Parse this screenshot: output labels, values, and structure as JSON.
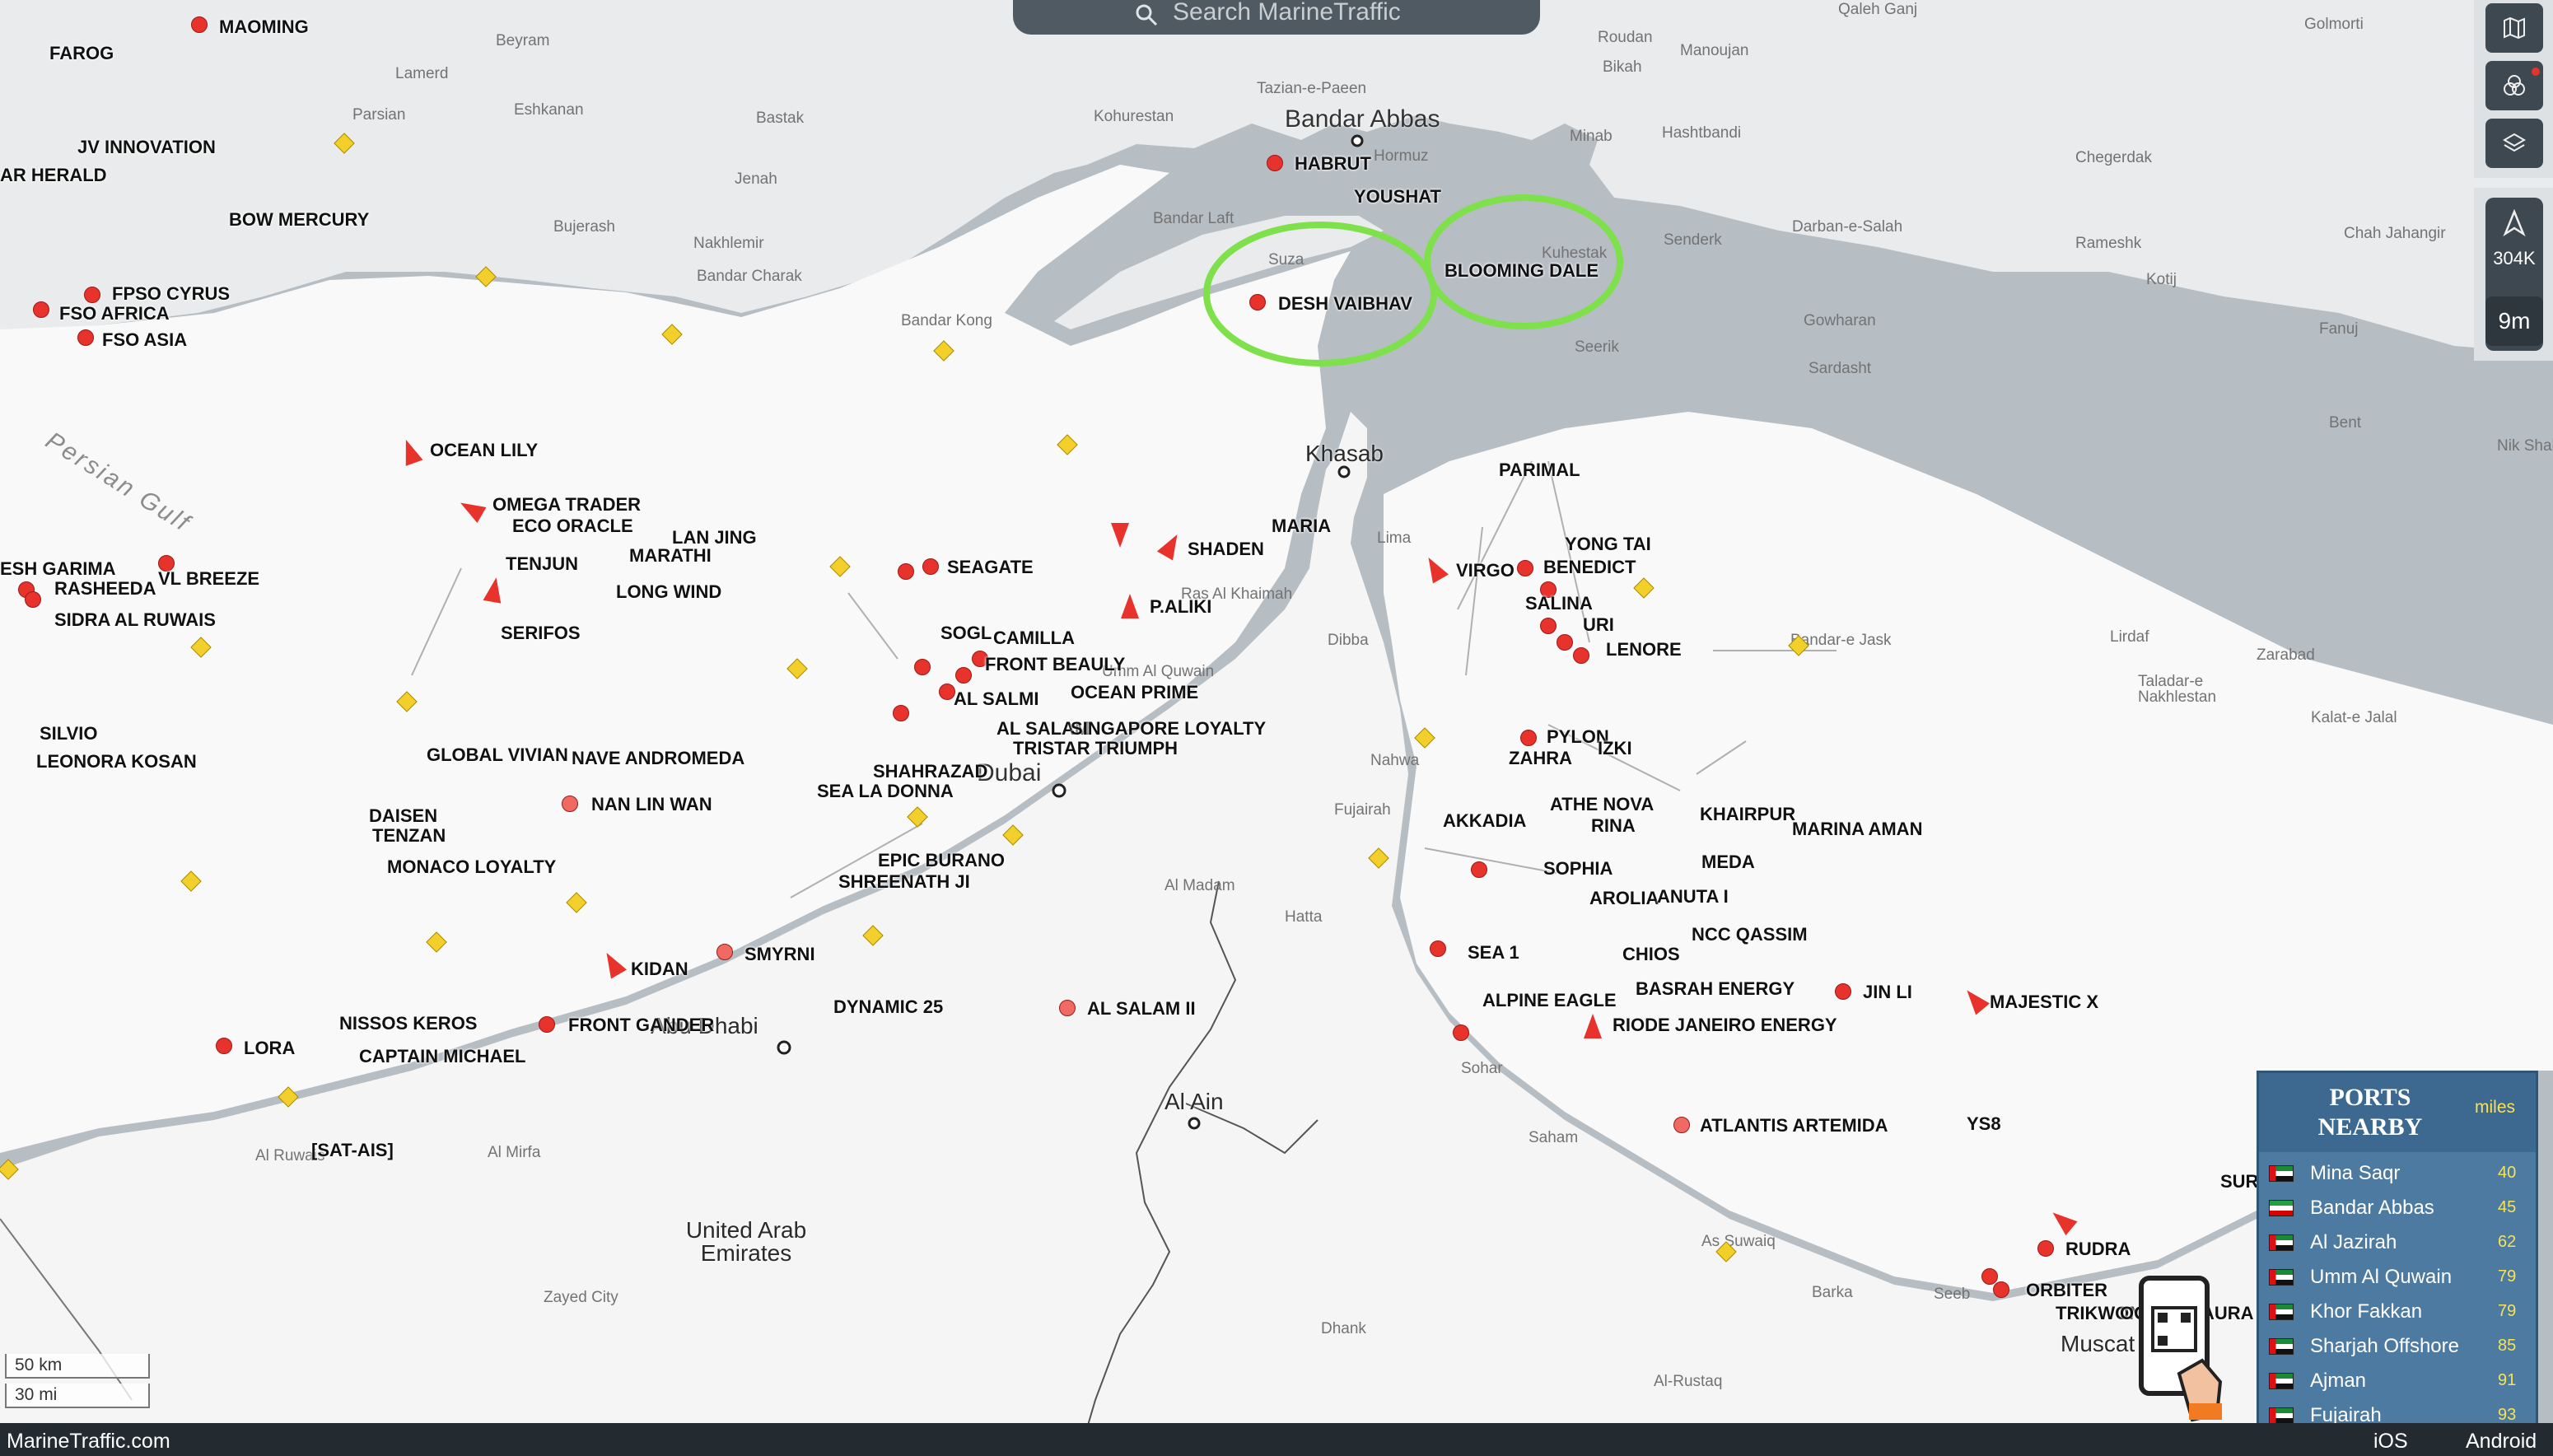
{
  "search": {
    "placeholder": "Search MarineTraffic"
  },
  "footer": {
    "brand": "MarineTraffic.com",
    "ios": "iOS",
    "android": "Android"
  },
  "zoom_panel": {
    "vessels": "304K",
    "range": "9m"
  },
  "scale": {
    "km": "50 km",
    "mi": "30 mi"
  },
  "ports_nearby": {
    "title": "PORTS NEARBY",
    "unit": "miles",
    "ports": [
      {
        "name": "Mina Saqr",
        "distance": "40",
        "flag": "uae"
      },
      {
        "name": "Bandar Abbas",
        "distance": "45",
        "flag": "iran"
      },
      {
        "name": "Al Jazirah",
        "distance": "62",
        "flag": "uae"
      },
      {
        "name": "Umm Al Quwain",
        "distance": "79",
        "flag": "uae"
      },
      {
        "name": "Khor Fakkan",
        "distance": "79",
        "flag": "uae"
      },
      {
        "name": "Sharjah Offshore",
        "distance": "85",
        "flag": "uae"
      },
      {
        "name": "Ajman",
        "distance": "91",
        "flag": "uae"
      },
      {
        "name": "Fujairah",
        "distance": "93",
        "flag": "uae"
      }
    ]
  },
  "map": {
    "highlight_color": "#7ee04a",
    "cities": [
      "Bandar Abbas",
      "Khasab",
      "Dubai",
      "Abu Dhabi",
      "Al Ain",
      "Muscat"
    ],
    "regions": [
      "Persian Gulf",
      "United Arab Emirates"
    ],
    "places": [
      "Beyram",
      "Lamerd",
      "Parsian",
      "Eshkanan",
      "Bastak",
      "Kohurestan",
      "Jenah",
      "Bujerash",
      "Nakhlemir",
      "Bandar Charak",
      "Bandar Laft",
      "Suza",
      "Hormuz",
      "Minab",
      "Hashtbandi",
      "Roudan",
      "Bikah",
      "Manoujan",
      "Qaleh Ganj",
      "Golmorti",
      "Chegerdak",
      "Tazian-e-Paeen",
      "Kuhestak",
      "Senderk",
      "Darban-e-Salah",
      "Rameshk",
      "Chah Jahangir",
      "Kotij",
      "Fanuj",
      "Gowharan",
      "Sardasht",
      "Seerik",
      "Bandar Kong",
      "Bent",
      "Nik Shahr",
      "Lirdaf",
      "Zarabad",
      "Taladar-e Nakhlestan",
      "Kalat-e Jalal",
      "Bandar-e Jask",
      "Lima",
      "Dibba",
      "Nahwa",
      "Fujairah",
      "Ras Al Khaimah",
      "Umm Al Quwain",
      "Al Madam",
      "Hatta",
      "Sohar",
      "Saham",
      "As Suwaiq",
      "Barka",
      "Seeb",
      "Al-Rustaq",
      "Dhank",
      "Zayed City",
      "Al Mirfa",
      "Al Ruwais"
    ],
    "vessels": [
      "MAOMING",
      "FAROG",
      "JV INNOVATION",
      "AR HERALD",
      "BOW MERCURY",
      "FPSO CYRUS",
      "FSO AFRICA",
      "FSO ASIA",
      "OCEAN LILY",
      "OMEGA TRADER",
      "ECO ORACLE",
      "LAN JING",
      "MARATHI",
      "TENJUN",
      "ESH GARIMA",
      "VL BREEZE",
      "RASHEEDA",
      "LONG WIND",
      "SIDRA AL RUWAIS",
      "SERIFOS",
      "SILVIO",
      "LEONORA KOSAN",
      "GLOBAL VIVIAN",
      "NAVE ANDROMEDA",
      "NAN LIN WAN",
      "DAISEN",
      "TENZAN",
      "MONACO LOYALTY",
      "KIDAN",
      "SMYRNI",
      "NISSOS KEROS",
      "FRONT GANDER",
      "CAPTAIN MICHAEL",
      "LORA",
      "[SAT-AIS]",
      "HABRUT",
      "YOUSHAT",
      "DESH VAIBHAV",
      "BLOOMING DALE",
      "SEAGATE",
      "SHADEN",
      "MARIA",
      "P.ALIKI",
      "SOGL",
      "CAMILLA",
      "FRONT BEAULY",
      "AL SALMI",
      "OCEAN PRIME",
      "AL SALAM",
      "SINGAPORE LOYALTY",
      "TRISTAR TRIUMPH",
      "SHAHRAZAD",
      "SEA LA DONNA",
      "EPIC BURANO",
      "SHREENATH JI",
      "DYNAMIC 25",
      "AL SALAM II",
      "PARIMAL",
      "YONG TAI",
      "VIRGO",
      "BENEDICT",
      "SALINA",
      "URI",
      "LENORE",
      "PYLON",
      "ZAHRA",
      "IZKI",
      "ATHE NOVA",
      "AKKADIA",
      "RINA",
      "KHAIRPUR",
      "MARINA AMAN",
      "SOPHIA",
      "MEDA",
      "AROLIA",
      "ANUTA I",
      "NCC QASSIM",
      "CHIOS",
      "SEA 1",
      "BASRAH ENERGY",
      "JIN LI",
      "MAJESTIC X",
      "ALPINE EAGLE",
      "RIODE JANEIRO ENERGY",
      "ATLANTIS ARTEMIDA",
      "YS8",
      "RUDRA",
      "ORBITER",
      "TRIKWONG",
      "OCEAN LAURA",
      "SURF"
    ]
  }
}
